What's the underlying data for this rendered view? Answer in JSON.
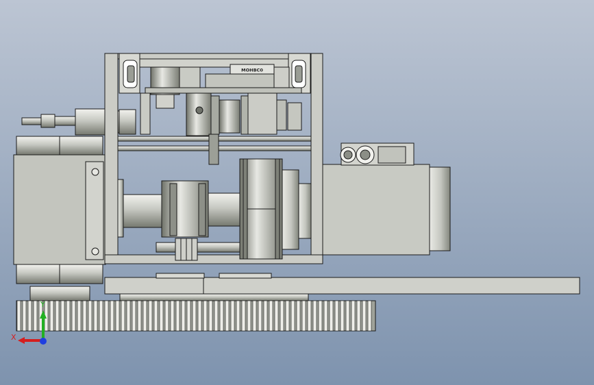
{
  "viewport": {
    "background_top": "#b9c3d2",
    "background_bottom": "#7f93ad",
    "part_color": "#c9cbc4",
    "part_dark": "#8e918a",
    "edge_color": "#1a1a1a"
  },
  "component_labels": {
    "bearing_block_plate": "MOHBC0"
  },
  "triad": {
    "x_label": "X",
    "y_label": "Y",
    "x_color": "#d51e1e",
    "y_color": "#22b022",
    "z_color": "#1f3fe0"
  }
}
